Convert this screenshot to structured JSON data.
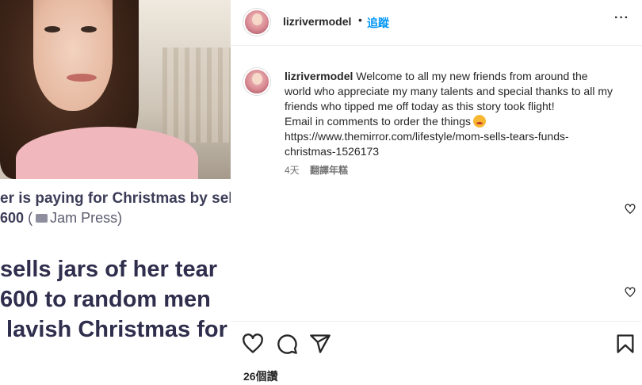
{
  "post": {
    "username": "lizrivermodel",
    "separator": "•",
    "follow_label": "追蹤",
    "more_label": "···"
  },
  "media": {
    "caption_line1": "er is paying for Christmas by selli",
    "caption_amount": "600",
    "caption_credit": "(📷 Jam Press)",
    "caption_credit_text": "Jam Press)",
    "caption_paren": "(",
    "headline_lines": [
      "sells jars of her tear",
      "600 to random men",
      " lavish Christmas for"
    ]
  },
  "comment": {
    "username": "lizrivermodel",
    "lines": [
      "Welcome to all my new friends from around the",
      "world who appreciate my many talents and special thanks to all my",
      "friends who tipped me off today as this story took flight!",
      "Email in comments to order the things",
      "https://www.themirror.com/lifestyle/mom-sells-tears-funds-",
      "christmas-1526173"
    ],
    "emoji": "kissing-face",
    "time": "4天",
    "translate_label": "翻譯年糕"
  },
  "actions": {
    "likes": "26個讚",
    "icons": [
      "heart-icon",
      "comment-icon",
      "share-icon",
      "bookmark-icon"
    ]
  },
  "colors": {
    "follow": "#0095f6",
    "headline": "#2f2e4d",
    "text": "#262626",
    "secondary": "#737373"
  }
}
